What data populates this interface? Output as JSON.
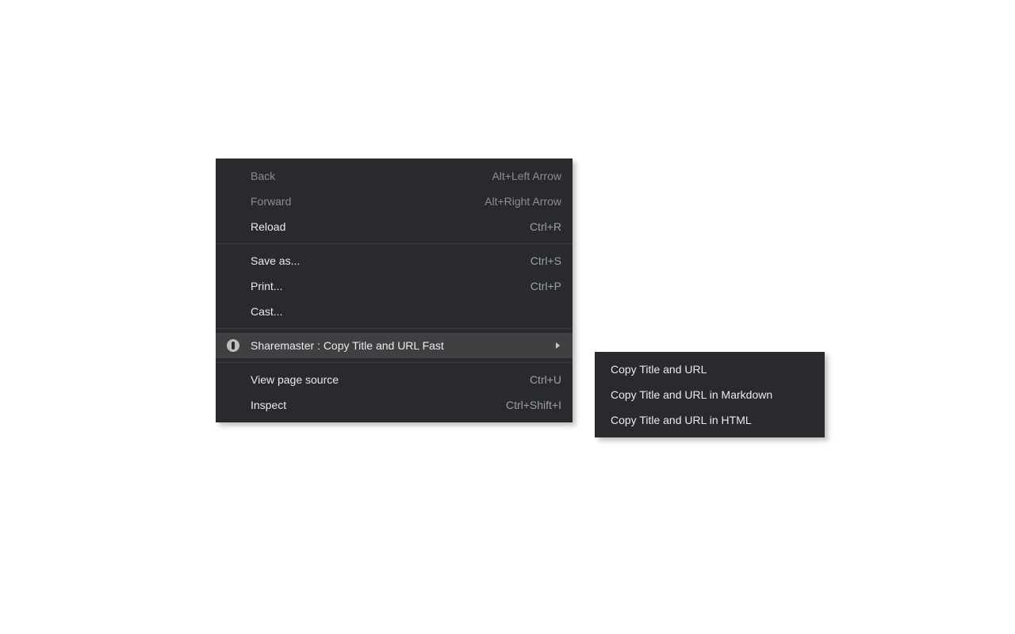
{
  "context_menu": {
    "groups": [
      [
        {
          "label": "Back",
          "shortcut": "Alt+Left Arrow",
          "enabled": false
        },
        {
          "label": "Forward",
          "shortcut": "Alt+Right Arrow",
          "enabled": false
        },
        {
          "label": "Reload",
          "shortcut": "Ctrl+R",
          "enabled": true
        }
      ],
      [
        {
          "label": "Save as...",
          "shortcut": "Ctrl+S",
          "enabled": true
        },
        {
          "label": "Print...",
          "shortcut": "Ctrl+P",
          "enabled": true
        },
        {
          "label": "Cast...",
          "shortcut": "",
          "enabled": true
        }
      ],
      [
        {
          "label": "Sharemaster : Copy Title and URL Fast",
          "shortcut": "",
          "enabled": true,
          "has_submenu": true,
          "icon": "extension",
          "highlight": true
        }
      ],
      [
        {
          "label": "View page source",
          "shortcut": "Ctrl+U",
          "enabled": true
        },
        {
          "label": "Inspect",
          "shortcut": "Ctrl+Shift+I",
          "enabled": true
        }
      ]
    ]
  },
  "submenu": {
    "items": [
      {
        "label": "Copy Title and URL"
      },
      {
        "label": "Copy Title and URL in Markdown"
      },
      {
        "label": "Copy Title and URL in HTML"
      }
    ]
  }
}
